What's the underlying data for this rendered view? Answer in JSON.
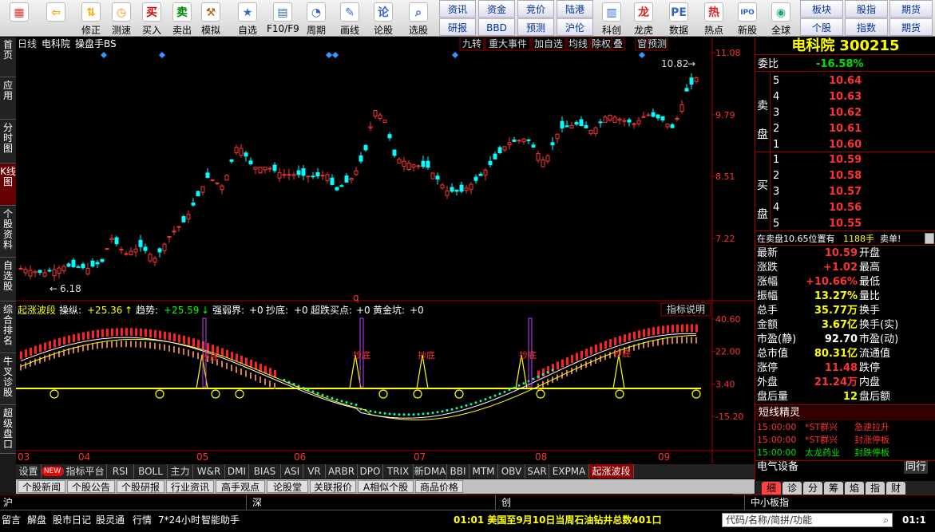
{
  "toolbar": {
    "buttons": [
      {
        "label": "",
        "icon": "windows-logo-icon"
      },
      {
        "label": "",
        "icon": "back-arrow-icon"
      },
      {
        "label": "修正",
        "icon": "up-down-arrow-icon"
      },
      {
        "label": "测速",
        "icon": "clock-icon"
      },
      {
        "label": "买入",
        "icon": "buy-icon"
      },
      {
        "label": "卖出",
        "icon": "sell-icon"
      },
      {
        "label": "模拟",
        "icon": "hammer-icon"
      },
      {
        "label": "自选",
        "icon": "star-icon"
      },
      {
        "label": "F10/F9",
        "icon": "f10-icon"
      },
      {
        "label": "周期",
        "icon": "period-icon"
      },
      {
        "label": "画线",
        "icon": "pencil-icon"
      },
      {
        "label": "论股",
        "icon": "chat-icon"
      },
      {
        "label": "选股",
        "icon": "magnifier-icon"
      }
    ],
    "grid": [
      "资讯",
      "资金",
      "竞价",
      "陆港",
      "研报",
      "BBD",
      "预测",
      "沪伦"
    ],
    "right_buttons": [
      {
        "label": "科创",
        "icon": "chart-icon"
      },
      {
        "label": "龙虎",
        "icon": "dragon-icon"
      },
      {
        "label": "数据",
        "icon": "pe-icon"
      },
      {
        "label": "热点",
        "icon": "hot-icon"
      },
      {
        "label": "新股",
        "icon": "ipo-icon"
      },
      {
        "label": "全球",
        "icon": "globe-icon"
      }
    ],
    "grid2": [
      "板块",
      "股指",
      "期货",
      "个股",
      "指数",
      "期货"
    ]
  },
  "left_tabs": [
    "首页",
    "应用",
    "分时图",
    "K线图",
    "个股资料",
    "自选股",
    "综合排名",
    "牛叉诊股",
    "超级盘口"
  ],
  "chart_header": {
    "period": "日线",
    "name": "电科院",
    "indicator": "操盘手BS",
    "buttons": [
      "九转",
      "重大事件",
      "加自选",
      "均线",
      "除权",
      "叠",
      "窗",
      "预测"
    ]
  },
  "price_axis": [
    "11.08",
    "9.79",
    "8.51",
    "7.22"
  ],
  "max_label": "10.82",
  "min_label": "6.18",
  "indicator_header": {
    "name": "起涨波段",
    "items": [
      {
        "k": "操纵:",
        "v": "+25.36",
        "c": "#ffff00",
        "arrow": "↑"
      },
      {
        "k": "趋势:",
        "v": "+25.59",
        "c": "#00ff00",
        "arrow": "↓"
      },
      {
        "k": "强弱界:",
        "v": "+0",
        "c": "#fff"
      },
      {
        "k": "抄底:",
        "v": "+0",
        "c": "#fff"
      },
      {
        "k": "超跌买点:",
        "v": "+0",
        "c": "#fff"
      },
      {
        "k": "黄金坑:",
        "v": "+0",
        "c": "#fff"
      }
    ],
    "explain": "指标说明"
  },
  "indicator_axis": [
    "40.60",
    "22.00",
    "3.40",
    "-15.20"
  ],
  "q_mark": "q",
  "chao_di": "抄底",
  "months": [
    "03",
    "04",
    "05",
    "06",
    "07",
    "08",
    "09"
  ],
  "bottom_tabs": [
    "设置",
    "NEW",
    "指标平台",
    "RSI",
    "BOLL",
    "主力",
    "W&R",
    "DMI",
    "BIAS",
    "ASI",
    "VR",
    "ARBR",
    "DPO",
    "TRIX",
    "新DMA",
    "BBI",
    "MTM",
    "OBV",
    "SAR",
    "EXPMA",
    "起涨波段"
  ],
  "tabs2": [
    "个股新闻",
    "个股公告",
    "个股研报",
    "行业资讯",
    "高手观点",
    "论股堂",
    "关联报价",
    "A相似个股",
    "商品价格"
  ],
  "stock": {
    "name": "电科院",
    "code": "300215"
  },
  "weibi": {
    "label": "委比",
    "value": "-16.58%"
  },
  "sell_label": "卖盘",
  "buy_label": "买盘",
  "asks": [
    {
      "n": "5",
      "p": "10.64"
    },
    {
      "n": "4",
      "p": "10.63"
    },
    {
      "n": "3",
      "p": "10.62"
    },
    {
      "n": "2",
      "p": "10.61"
    },
    {
      "n": "1",
      "p": "10.60"
    }
  ],
  "bids": [
    {
      "n": "1",
      "p": "10.59"
    },
    {
      "n": "2",
      "p": "10.58"
    },
    {
      "n": "3",
      "p": "10.57"
    },
    {
      "n": "4",
      "p": "10.56"
    },
    {
      "n": "5",
      "p": "10.55"
    }
  ],
  "sell_note": {
    "text": "在卖盘10.65位置有",
    "vol": "1188手",
    "tag": "卖单!"
  },
  "quotes": [
    {
      "l": "最新",
      "v": "10.59",
      "r": "开盘",
      "c": "#ff3232"
    },
    {
      "l": "涨跌",
      "v": "+1.02",
      "r": "最高",
      "c": "#ff3232"
    },
    {
      "l": "涨幅",
      "v": "+10.66%",
      "r": "最低",
      "c": "#ff3232"
    },
    {
      "l": "振幅",
      "v": "13.27%",
      "r": "量比",
      "c": "#ffff00"
    },
    {
      "l": "总手",
      "v": "35.77万",
      "r": "换手",
      "c": "#ffff00"
    },
    {
      "l": "金额",
      "v": "3.67亿",
      "r": "换手(实)",
      "c": "#ffff00"
    },
    {
      "l": "市盈(静)",
      "v": "92.70",
      "r": "市盈(动)",
      "c": "#fff"
    },
    {
      "l": "总市值",
      "v": "80.31亿",
      "r": "流通值",
      "c": "#ffff00"
    },
    {
      "l": "涨停",
      "v": "11.48",
      "r": "跌停",
      "c": "#ff3232"
    },
    {
      "l": "外盘",
      "v": "21.24万",
      "r": "内盘",
      "c": "#ff3232"
    },
    {
      "l": "盘后量",
      "v": "12",
      "r": "盘后额",
      "c": "#ffff00"
    }
  ],
  "sprite_title": "短线精灵",
  "sprites": [
    {
      "t": "15:00:00",
      "s": "*ST群兴",
      "e": "急速拉升",
      "c": "#ff3232"
    },
    {
      "t": "15:00:00",
      "s": "*ST群兴",
      "e": "封涨停板",
      "c": "#ff3232"
    },
    {
      "t": "15:00:00",
      "s": "太龙药业",
      "e": "封跌停板",
      "c": "#00e000"
    }
  ],
  "industry": "电气设备",
  "industry_tab": "同行",
  "info_tabs": [
    "细",
    "诊",
    "分",
    "筹",
    "焰",
    "指",
    "财"
  ],
  "idx_labels": [
    "沪",
    "深",
    "创",
    "中小板指"
  ],
  "status": {
    "items": [
      "留言",
      "解盘",
      "股市日记",
      "股灵通",
      "行情",
      "7*24小时",
      "智能助手"
    ],
    "news": "01:01 美国至9月10日当周石油钻井总数401口",
    "search": "代码/名称/简拼/功能",
    "clock": "01:1"
  }
}
